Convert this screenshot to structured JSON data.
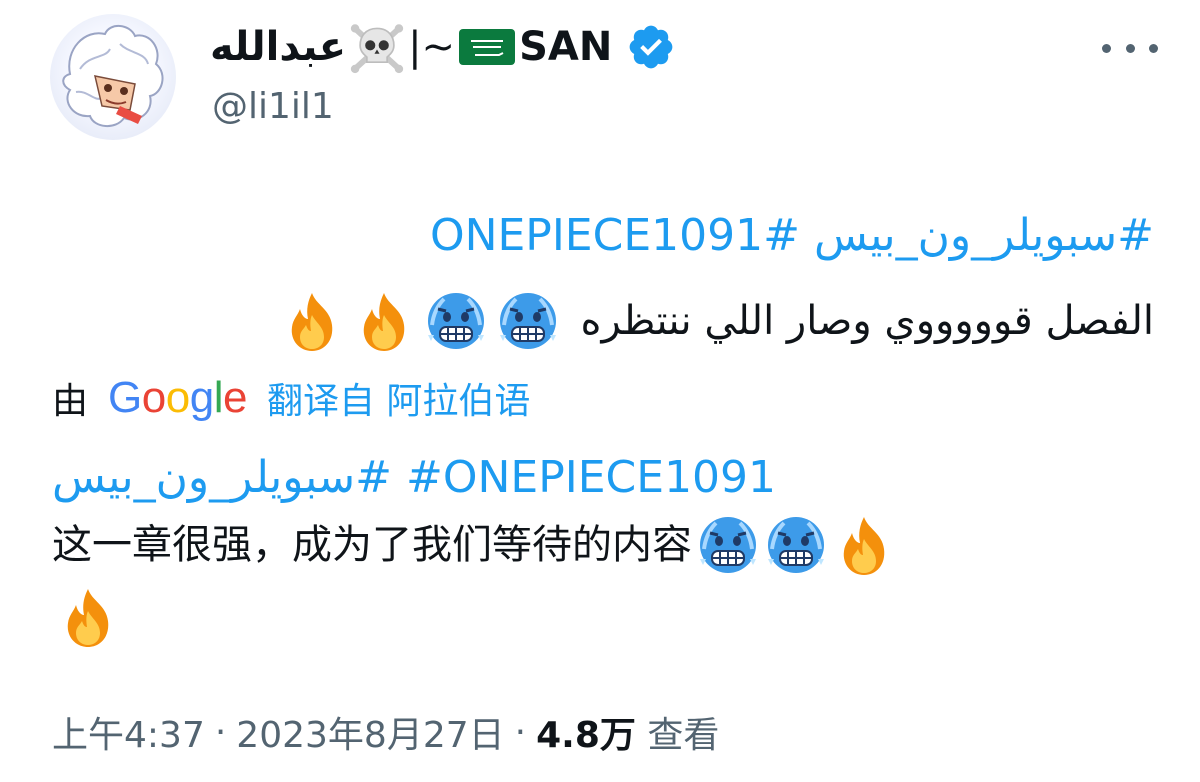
{
  "author": {
    "name_arabic": "عبدالله",
    "name_separator": "|~",
    "name_latin": "SAN",
    "handle": "@li1il1",
    "verified": true
  },
  "original": {
    "hashtag_arabic": "#سبويلر_ون_بيس",
    "hashtag_latin": "#ONEPIECE1091",
    "text": "الفصل قوووووي وصار اللي ننتظره",
    "emojis": [
      "cold-face",
      "cold-face",
      "fire",
      "fire"
    ]
  },
  "translation_bar": {
    "by": "由",
    "google_letters": [
      "G",
      "o",
      "o",
      "g",
      "l",
      "e"
    ],
    "from_language": "翻译自 阿拉伯语"
  },
  "translated": {
    "hashtag_arabic": "#سبويلر_ون_بيس",
    "hashtag_latin": "#ONEPIECE1091",
    "text": "这一章很强，成为了我们等待的内容",
    "emojis": [
      "cold-face",
      "cold-face",
      "fire",
      "fire"
    ]
  },
  "footer": {
    "time": "上午4:37",
    "date": "2023年8月27日",
    "views_count": "4.8万",
    "views_label": "查看",
    "separator": "·"
  },
  "colors": {
    "link": "#1d9bf0",
    "secondary_text": "#536471",
    "primary_text": "#0f1419",
    "verified_badge": "#1d9bf0"
  }
}
